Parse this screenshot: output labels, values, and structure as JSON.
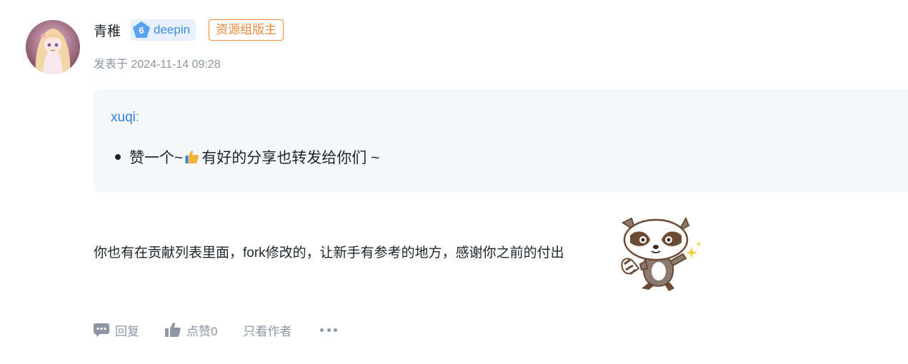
{
  "post": {
    "username": "青稚",
    "level": "6",
    "level_name": "deepin",
    "role": "资源组版主",
    "meta_prefix": "发表于",
    "date": "2024-11-14 09:28",
    "quote": {
      "author": "xuqi",
      "colon": ":",
      "item_before": "赞一个~",
      "item_after": "有好的分享也转发给你们 ~"
    },
    "body": "你也有在贡献列表里面，fork修改的，让新手有参考的地方，感谢你之前的付出"
  },
  "actions": {
    "reply": "回复",
    "like": "点赞0",
    "only_author": "只看作者"
  },
  "colors": {
    "accent": "#2f80e8",
    "role": "#f0893c",
    "muted": "#8c96a4",
    "quote_bg": "#f6f7f9"
  }
}
